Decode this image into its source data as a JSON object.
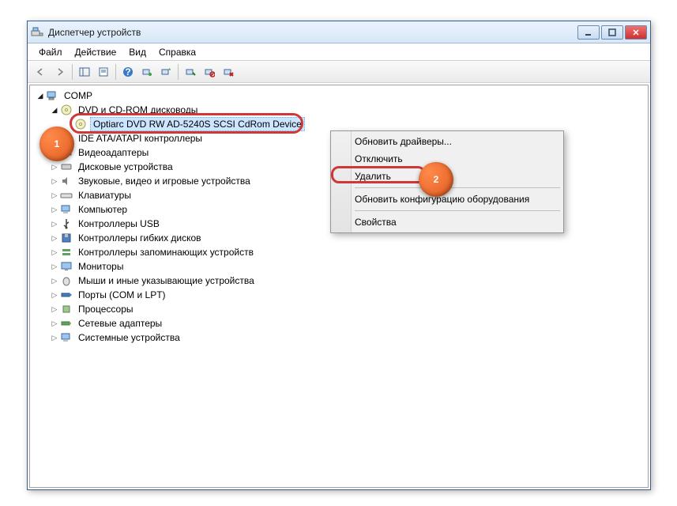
{
  "title": "Диспетчер устройств",
  "menu": {
    "file": "Файл",
    "action": "Действие",
    "view": "Вид",
    "help": "Справка"
  },
  "tree": {
    "root": "COMP",
    "cat_dvd": "DVD и CD-ROM дисководы",
    "dev_dvd": "Optiarc DVD RW AD-5240S SCSI CdRom Device",
    "cat_ide": "IDE ATA/ATAPI контроллеры",
    "cat_video": "Видеоадаптеры",
    "cat_disk": "Дисковые устройства",
    "cat_sound": "Звуковые, видео и игровые устройства",
    "cat_keyboard": "Клавиатуры",
    "cat_computer": "Компьютер",
    "cat_usb": "Контроллеры USB",
    "cat_floppy": "Контроллеры гибких дисков",
    "cat_storage": "Контроллеры запоминающих устройств",
    "cat_monitor": "Мониторы",
    "cat_mouse": "Мыши и иные указывающие устройства",
    "cat_ports": "Порты (COM и LPT)",
    "cat_cpu": "Процессоры",
    "cat_net": "Сетевые адаптеры",
    "cat_system": "Системные устройства"
  },
  "context": {
    "update_drivers": "Обновить драйверы...",
    "disable": "Отключить",
    "uninstall": "Удалить",
    "scan_hw": "Обновить конфигурацию оборудования",
    "properties": "Свойства"
  },
  "markers": {
    "m1": "1",
    "m2": "2"
  }
}
